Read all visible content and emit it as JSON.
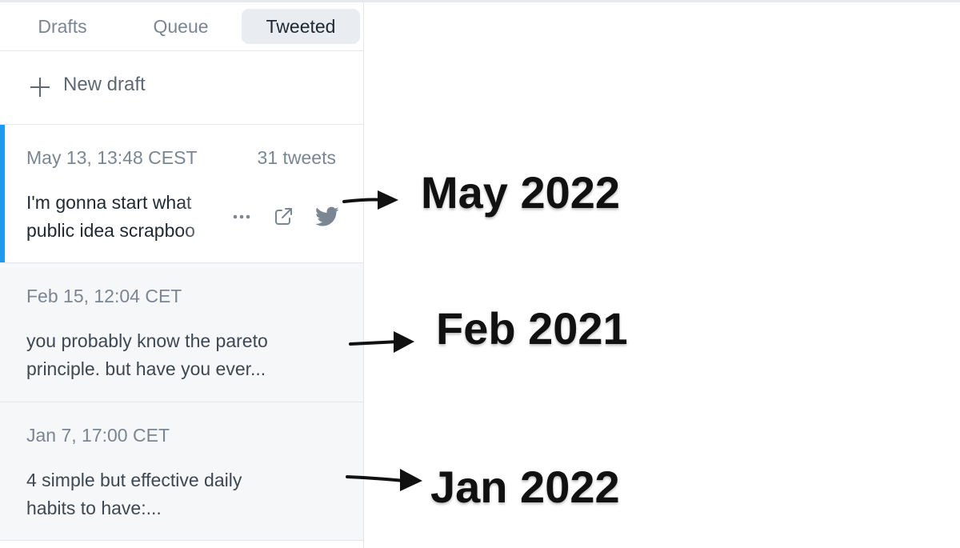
{
  "tabs": [
    {
      "label": "Drafts"
    },
    {
      "label": "Queue"
    },
    {
      "label": "Tweeted",
      "selected": true
    }
  ],
  "new_draft": {
    "label": "New draft",
    "icon": "plus-icon"
  },
  "items": [
    {
      "date": "May 13, 13:48 CEST",
      "count": "31 tweets",
      "preview_lines": [
        "I'm gonna start what",
        "public idea scrapboo"
      ],
      "active": true,
      "actions": [
        "more-options-icon",
        "share-icon",
        "twitter-bird-icon"
      ]
    },
    {
      "date": "Feb 15, 12:04 CET",
      "preview_lines": [
        "you probably know the pareto",
        "principle. but have you ever..."
      ]
    },
    {
      "date": "Jan 7, 17:00 CET",
      "preview_lines": [
        "4 simple but effective daily",
        "habits to have:..."
      ]
    }
  ],
  "annotations": [
    {
      "label": "May 2022"
    },
    {
      "label": "Feb 2021"
    },
    {
      "label": "Jan 2022"
    }
  ],
  "colors": {
    "accent": "#1d9bf0",
    "selected_tab_bg": "#e9ecf0",
    "muted_text": "#7b8693",
    "item_bg": "#f6f7f8"
  }
}
